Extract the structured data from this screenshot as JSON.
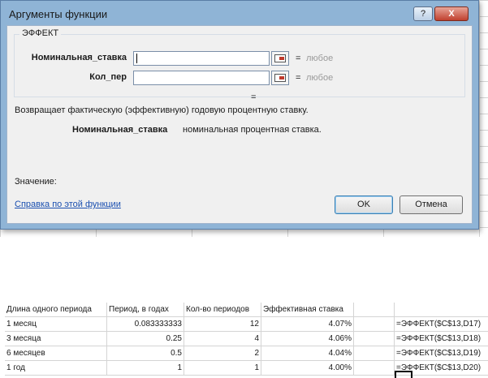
{
  "dialog": {
    "title": "Аргументы функции",
    "help_btn": "?",
    "close_btn": "X",
    "function_name": "ЭФФЕКТ",
    "args": [
      {
        "label": "Номинальная_ставка",
        "value": "",
        "eq": "=",
        "result": "любое"
      },
      {
        "label": "Кол_пер",
        "value": "",
        "eq": "=",
        "result": "любое"
      }
    ],
    "result_eq": "=",
    "description": "Возвращает фактическую (эффективную) годовую процентную ставку.",
    "arg_desc_name": "Номинальная_ставка",
    "arg_desc_text": "номинальная процентная ставка.",
    "value_label": "Значение:",
    "help_link": "Справка по этой функции",
    "ok": "OK",
    "cancel": "Отмена"
  },
  "sheet": {
    "headers": [
      "Длина одного периода",
      "Период, в годах",
      "Кол-во периодов",
      "Эффективная ставка",
      "",
      ""
    ],
    "rows": [
      [
        "1 месяц",
        "0.083333333",
        "12",
        "4.07%",
        "",
        "=ЭФФЕКТ($C$13,D17)"
      ],
      [
        "3 месяца",
        "0.25",
        "4",
        "4.06%",
        "",
        "=ЭФФЕКТ($C$13,D18)"
      ],
      [
        "6 месяцев",
        "0.5",
        "2",
        "4.04%",
        "",
        "=ЭФФЕКТ($C$13,D19)"
      ],
      [
        "1 год",
        "1",
        "1",
        "4.00%",
        "",
        "=ЭФФЕКТ($C$13,D20)"
      ]
    ]
  }
}
